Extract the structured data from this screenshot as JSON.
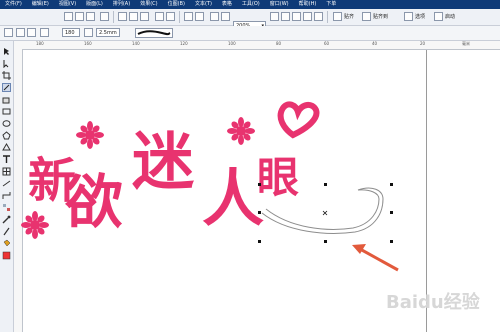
{
  "menubar": {
    "items": [
      "文件(F)",
      "编辑(E)",
      "视图(V)",
      "版面(L)",
      "排列(A)",
      "效果(C)",
      "位图(B)",
      "文本(T)",
      "表格",
      "工具(O)",
      "窗口(W)",
      "帮助(H)",
      "下单"
    ]
  },
  "toolbar": {
    "zoom_value": "200%",
    "buttons": [
      "new",
      "open",
      "save",
      "print",
      "cut",
      "copy",
      "paste",
      "undo",
      "redo",
      "import",
      "export",
      "app-launcher",
      "zoom",
      "snap",
      "welcome",
      "options"
    ],
    "right_labels": [
      "贴齐",
      "贴齐到",
      "选项",
      "启动"
    ]
  },
  "property_bar": {
    "angle_value": "180",
    "size_value": "2.5mm"
  },
  "ruler": {
    "top_ticks": [
      "180",
      "160",
      "140",
      "120",
      "100",
      "80",
      "60",
      "40",
      "20"
    ],
    "unit": "毫米"
  },
  "artwork": {
    "chars": [
      "新",
      "欲",
      "迷",
      "人",
      "眼"
    ],
    "color": "#e8336f"
  },
  "watermark": "Baidu经验",
  "colors": {
    "menubar": "#0e3a78",
    "accent": "#e8336f",
    "arrow": "#e25a3c"
  }
}
